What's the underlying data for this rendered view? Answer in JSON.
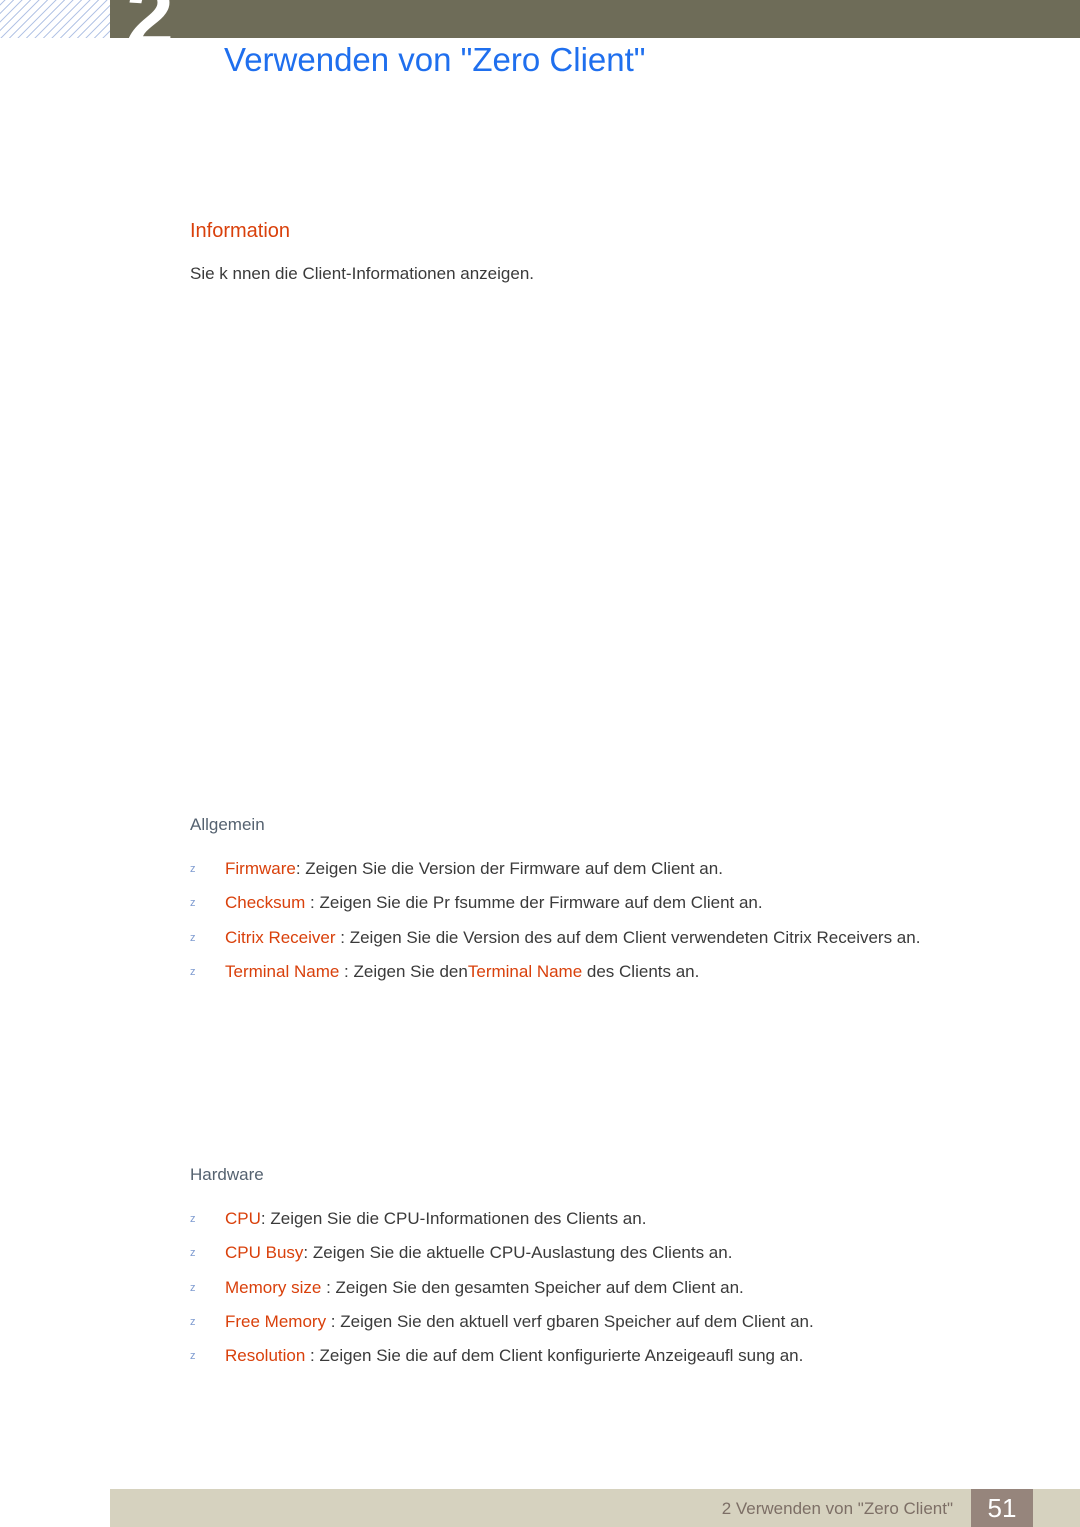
{
  "header": {
    "chapter_number": "2",
    "title": "Verwenden von \"Zero Client\"",
    "bar_color": "#6E6C58",
    "title_color": "#1F6FEE"
  },
  "content": {
    "section_heading": "Information",
    "section_heading_color": "#D9400B",
    "intro_text": "Sie k nnen die Client-Informationen anzeigen.",
    "groups": [
      {
        "label": "Allgemein",
        "label_color": "#556270",
        "bullet_marker": "z",
        "items": [
          {
            "term": "Firmware",
            "separator": ": ",
            "description": "Zeigen Sie die Version der Firmware auf dem Client an.",
            "description_tail": ""
          },
          {
            "term": "Checksum",
            "separator": " : ",
            "description": "Zeigen Sie die Pr fsumme der Firmware auf dem Client an.",
            "description_tail": ""
          },
          {
            "term": "Citrix Receiver",
            "separator": " : ",
            "description": "Zeigen Sie die Version des auf dem Client verwendeten Citrix Receivers an.",
            "description_tail": ""
          },
          {
            "term": "Terminal Name",
            "separator": " : ",
            "description": "Zeigen Sie den",
            "inline_term": "Terminal Name",
            "description_tail": " des Clients an."
          }
        ]
      },
      {
        "label": "Hardware",
        "label_color": "#556270",
        "bullet_marker": "z",
        "items": [
          {
            "term": "CPU",
            "separator": ": ",
            "description": "Zeigen Sie die CPU-Informationen des Clients an.",
            "description_tail": ""
          },
          {
            "term": "CPU Busy",
            "separator": ": ",
            "description": "Zeigen Sie die aktuelle CPU-Auslastung des Clients an.",
            "description_tail": ""
          },
          {
            "term": "Memory size",
            "separator": " : ",
            "description": "Zeigen Sie den gesamten Speicher auf dem Client an.",
            "description_tail": ""
          },
          {
            "term": "Free Memory",
            "separator": " : ",
            "description": "Zeigen Sie den aktuell verf gbaren Speicher auf dem Client an.",
            "description_tail": ""
          },
          {
            "term": "Resolution",
            "separator": " : ",
            "description": "Zeigen Sie die auf dem Client konfigurierte Anzeigeaufl sung an.",
            "description_tail": ""
          }
        ]
      }
    ]
  },
  "footer": {
    "text": "2 Verwenden von \"Zero Client\"",
    "page_number": "51",
    "bar_color": "#D6D2BF",
    "page_box_color": "#96857C"
  }
}
